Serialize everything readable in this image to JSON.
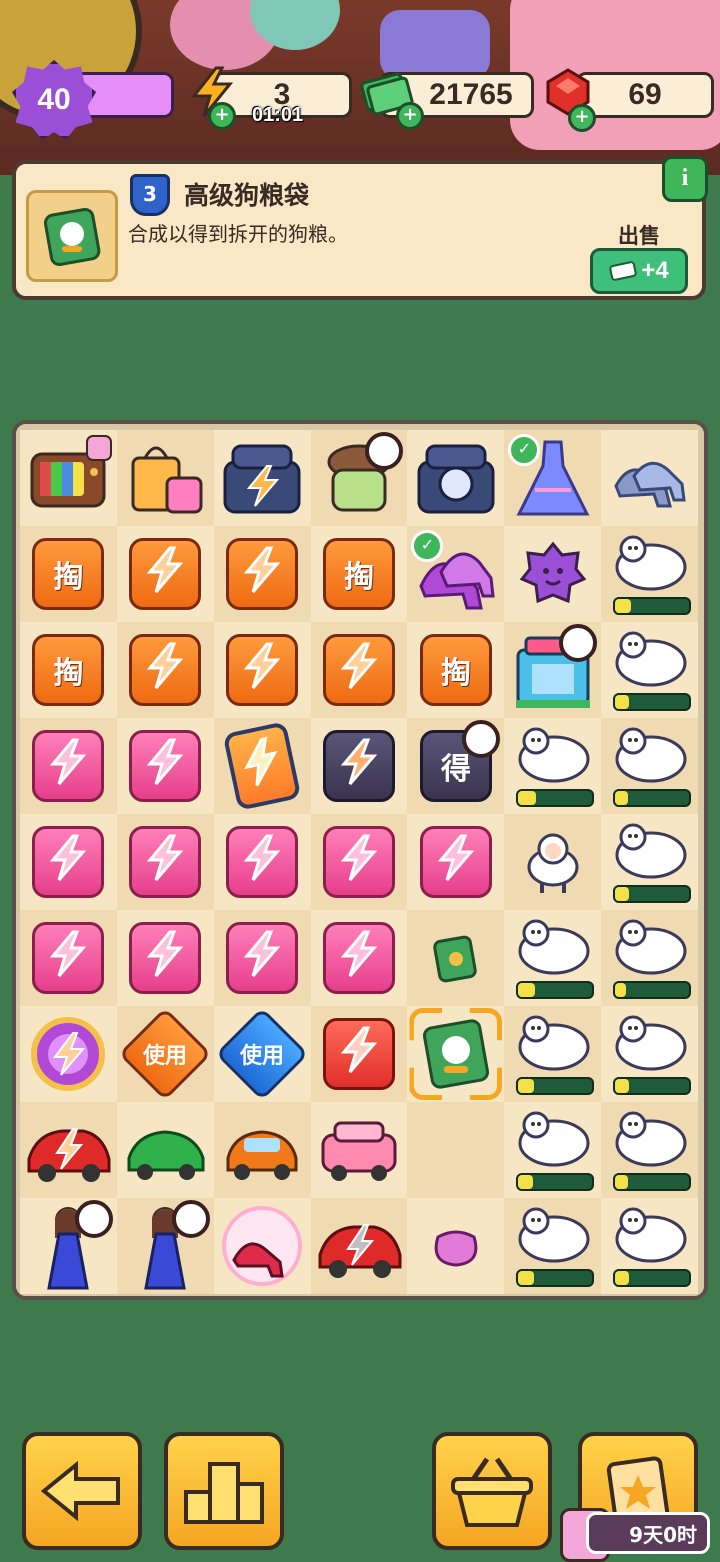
{
  "hud": {
    "level": "40",
    "energy": "3",
    "energy_timer": "01:01",
    "cash": "21765",
    "gems": "69"
  },
  "info_panel": {
    "item_level": "3",
    "item_name": "高级狗粮袋",
    "item_desc": "合成以得到拆开的狗粮。",
    "sell_label": "出售",
    "sell_value": "+4",
    "info_button": "i"
  },
  "board": {
    "rows": [
      [
        "tv",
        "shopping-bag",
        "lightning-phone",
        "cookie-jar",
        "dog-phone",
        "ball-gown",
        "glass-slippers"
      ],
      [
        "tile-tao",
        "tile-lightning",
        "tile-lightning",
        "tile-tao",
        "purple-slippers",
        "purple-gem",
        "sheep-timer"
      ],
      [
        "tile-tao",
        "tile-lightning",
        "tile-lightning",
        "tile-lightning",
        "tile-tao",
        "mall",
        "sheep-timer"
      ],
      [
        "tile-pink-lightning",
        "tile-pink-lightning",
        "phone-lightning",
        "dark-lightning",
        "tile-de",
        "sheep-timer",
        "sheep-timer"
      ],
      [
        "tile-pink-lightning",
        "tile-pink-lightning",
        "tile-pink-lightning",
        "tile-pink-lightning",
        "tile-pink-lightning",
        "sheep",
        "sheep-timer"
      ],
      [
        "tile-pink-lightning",
        "tile-pink-lightning",
        "tile-pink-lightning",
        "tile-pink-lightning",
        "dog-food-small",
        "sheep-timer",
        "sheep-timer"
      ],
      [
        "bracelet",
        "use-orange",
        "use-blue",
        "red-lightning",
        "dog-food-bag",
        "sheep-timer",
        "sheep-timer"
      ],
      [
        "red-sportscar",
        "green-car",
        "orange-car",
        "pink-car",
        "empty",
        "sheep-timer",
        "sheep-timer"
      ],
      [
        "lady",
        "lady",
        "red-heels",
        "red-sportscar-lightning",
        "pink-pouch",
        "sheep-timer",
        "sheep-timer"
      ]
    ],
    "tile_tao_text": "掏",
    "tile_de_text": "得",
    "use_text": "使用"
  },
  "bottom": {
    "timer_badge": "9天0时"
  },
  "colors": {
    "board_bg": "#f7e6c4",
    "accent_green": "#3fb65a",
    "button_yellow": "#ffd24a"
  }
}
